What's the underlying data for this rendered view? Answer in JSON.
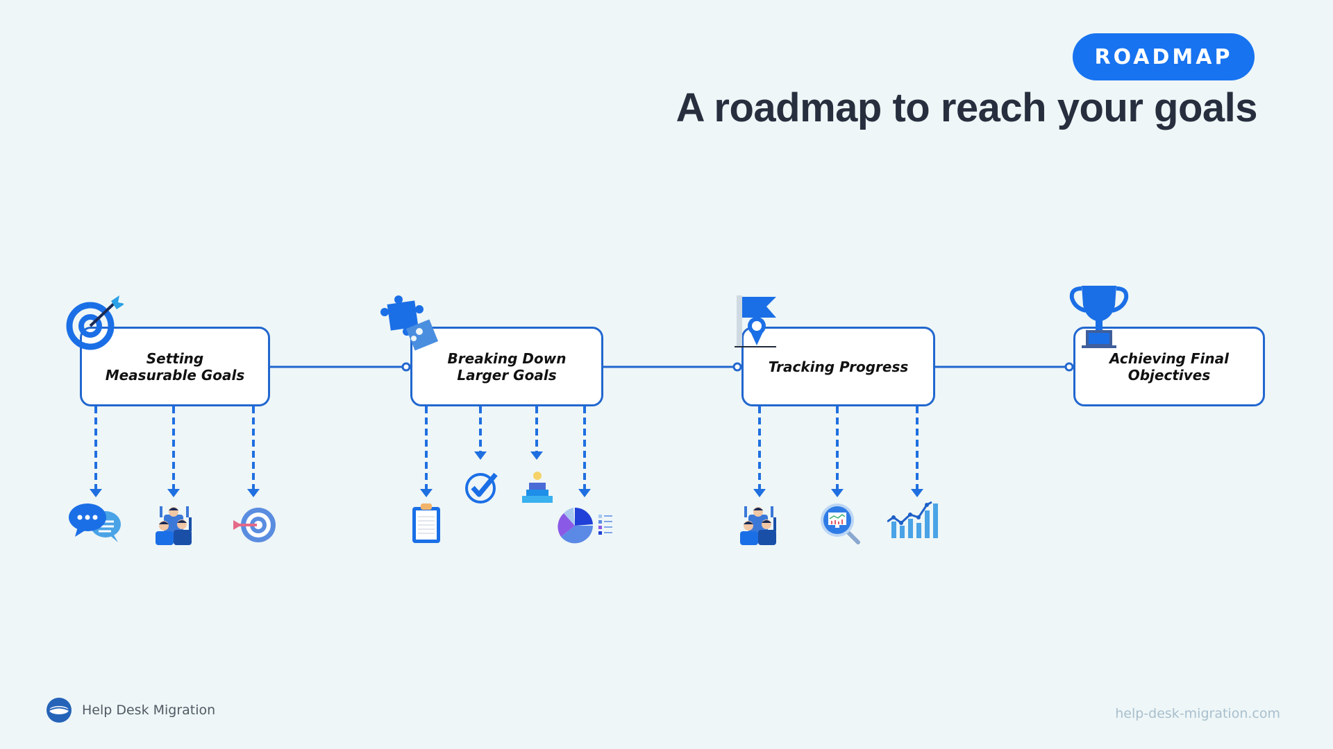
{
  "header": {
    "badge": "ROADMAP",
    "title": "A roadmap to reach your goals"
  },
  "colors": {
    "accent": "#1773f0",
    "line": "#2167cf",
    "title": "#272f3f",
    "background": "#eef6f7"
  },
  "steps": [
    {
      "label": "Setting\nMeasurable Goals",
      "icon": "target-with-arrow-icon",
      "children": [
        "chat-bubbles-icon",
        "team-celebrating-icon",
        "target-hit-icon"
      ]
    },
    {
      "label": "Breaking Down\nLarger Goals",
      "icon": "puzzle-pieces-icon",
      "children": [
        "clipboard-icon",
        "checkmark-circle-icon",
        "stacked-steps-icon",
        "pie-chart-legend-icon"
      ]
    },
    {
      "label": "Tracking Progress",
      "icon": "flag-location-pin-icon",
      "children": [
        "team-celebrating-icon",
        "magnifier-monitor-chart-icon",
        "growth-bar-chart-icon"
      ]
    },
    {
      "label": "Achieving Final\nObjectives",
      "icon": "trophy-icon",
      "children": []
    }
  ],
  "footer": {
    "brand": "Help Desk Migration",
    "url": "help-desk-migration.com"
  }
}
